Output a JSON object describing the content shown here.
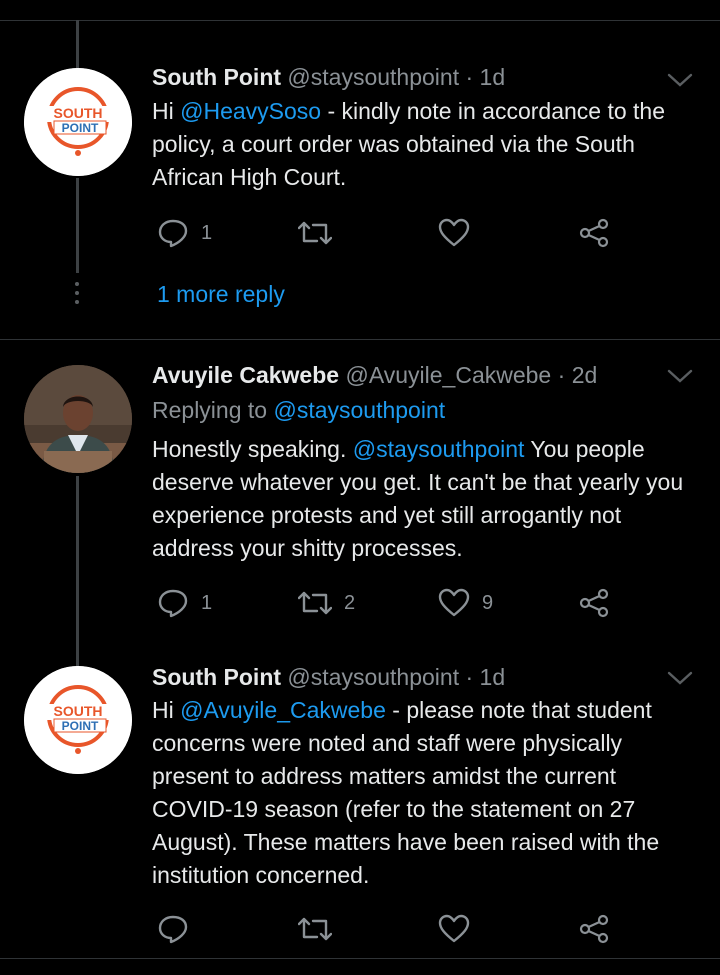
{
  "tweets": [
    {
      "name": "South Point",
      "handle": "@staysouthpoint",
      "sep": "·",
      "time": "1d",
      "avatar_text_top": "SOUTH",
      "avatar_text_bottom": "POINT",
      "body_prefix": "Hi ",
      "body_mention": "@HeavySoso",
      "body_rest": " - kindly note in accordance to the policy, a court order was obtained via the South African High Court.",
      "replies": "1",
      "retweets": "",
      "likes": ""
    },
    {
      "name": "Avuyile Cakwebe",
      "handle": "@Avuyile_Cakwebe",
      "sep": "·",
      "time": "2d",
      "replying_label": "Replying to ",
      "replying_to": "@staysouthpoint",
      "body_prefix": "Honestly speaking. ",
      "body_mention": "@staysouthpoint",
      "body_rest": "  You people deserve whatever you get. It can't  be that yearly you experience protests and yet still arrogantly not address your shitty processes.",
      "replies": "1",
      "retweets": "2",
      "likes": "9"
    },
    {
      "name": "South Point",
      "handle": "@staysouthpoint",
      "sep": "·",
      "time": "1d",
      "avatar_text_top": "SOUTH",
      "avatar_text_bottom": "POINT",
      "body_prefix": "Hi ",
      "body_mention": "@Avuyile_Cakwebe",
      "body_rest": " - please note that student concerns were noted and staff were physically present to address matters amidst the current COVID-19 season (refer to the statement on 27 August). These matters have been raised with the institution concerned.",
      "replies": "",
      "retweets": "",
      "likes": ""
    }
  ],
  "more_reply": "1 more reply",
  "colors": {
    "background": "#000000",
    "link": "#1d9bf0",
    "muted": "#8b9196",
    "logo_orange": "#e8562a",
    "logo_blue": "#2d6fb4"
  },
  "icons": [
    "reply-icon",
    "retweet-icon",
    "like-icon",
    "share-icon",
    "chevron-down-icon"
  ]
}
